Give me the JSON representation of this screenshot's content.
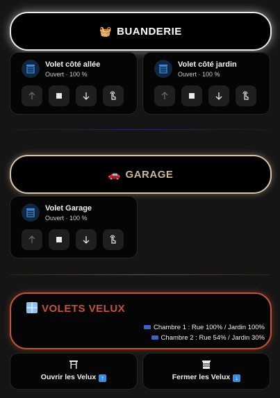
{
  "buanderie": {
    "emoji": "🧺",
    "title": "BUANDERIE",
    "cards": [
      {
        "name": "Volet côté allée",
        "state": "Ouvert · 100 %"
      },
      {
        "name": "Volet côté jardin",
        "state": "Ouvert · 100 %"
      }
    ]
  },
  "garage": {
    "emoji": "🚗",
    "title": "GARAGE",
    "cards": [
      {
        "name": "Volet Garage",
        "state": "Ouvert · 100 %"
      }
    ]
  },
  "velux": {
    "title": "VOLETS VELUX",
    "lines": [
      "Chambre 1 : Rue 100% / Jardin 100%",
      "Chambre 2 : Rue 54% / Jardin 30%"
    ]
  },
  "actions": {
    "open_label": "Ouvrir les Velux",
    "close_label": "Fermer les Velux",
    "open_badge": "↑",
    "close_badge": "↓"
  },
  "colors": {
    "accent_velux": "#c4533a",
    "accent_garage": "#c9b89a",
    "icon_blue": "#3a8ee6"
  }
}
